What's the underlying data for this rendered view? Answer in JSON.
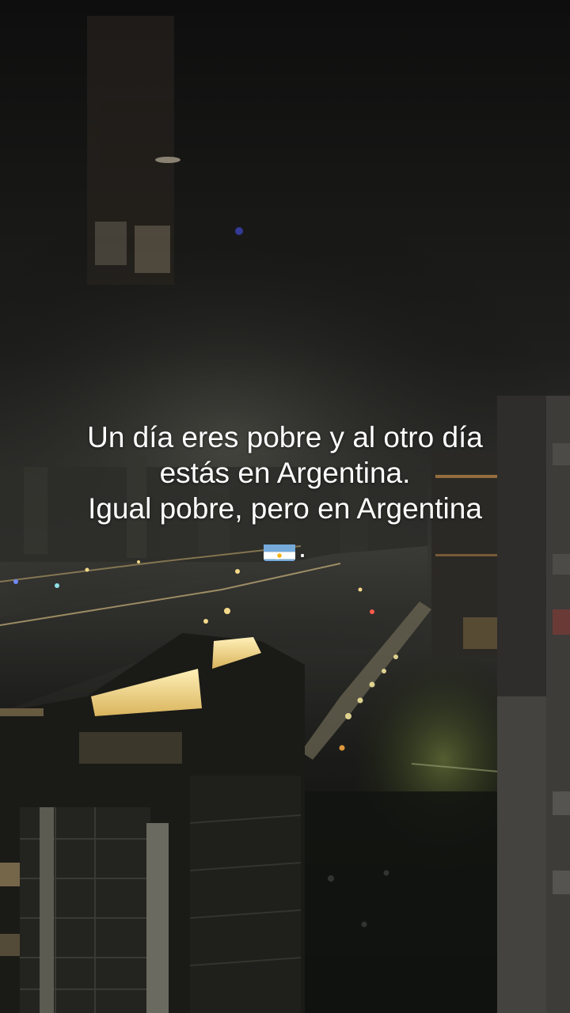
{
  "caption": {
    "line1": "Un día eres pobre y al otro día",
    "line2": "estás en Argentina.",
    "line3": "Igual pobre, pero en Argentina",
    "trailing": ".",
    "flag_icon": "argentina-flag-icon"
  },
  "colors": {
    "caption_text": "#ffffff",
    "flag_blue": "#75aadb",
    "flag_white": "#ffffff",
    "flag_sun": "#f6b40e",
    "city_lights": "#f3d98a",
    "sky": "#1c1c1a"
  }
}
